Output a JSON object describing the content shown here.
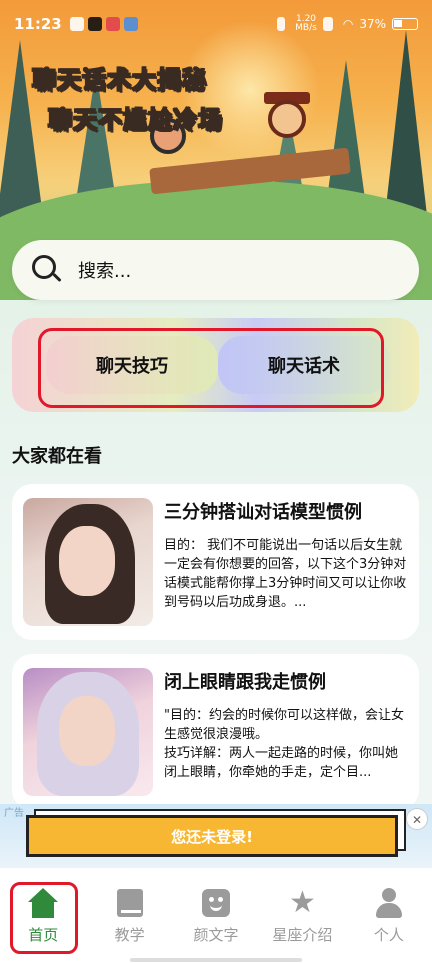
{
  "status_bar": {
    "time": "11:23",
    "network_speed": "1.20\nMB/s",
    "battery": "37%"
  },
  "hero": {
    "line1": "聊天话术大揭秘",
    "line2": "聊天不尴尬冷场"
  },
  "search": {
    "placeholder": "搜索..."
  },
  "features": [
    {
      "label": "聊天技巧"
    },
    {
      "label": "聊天话术"
    }
  ],
  "section": {
    "title": "大家都在看"
  },
  "cards": [
    {
      "title": "三分钟搭讪对话模型惯例",
      "desc": "目的： 我们不可能说出一句话以后女生就一定会有你想要的回答，以下这个3分钟对话模式能帮你撑上3分钟时间又可以让你收到号码以后功成身退。..."
    },
    {
      "title": "闭上眼睛跟我走惯例",
      "desc": "\"目的：约会的时候你可以这样做，会让女生感觉很浪漫哦。\n技巧详解：两人一起走路的时候，你叫她闭上眼睛，你牵她的手走，定个目..."
    }
  ],
  "ad": {
    "label": "广告",
    "banner": "您还未登录!",
    "close": "✕"
  },
  "nav": [
    {
      "label": "首页",
      "icon": "home-icon",
      "active": true
    },
    {
      "label": "教学",
      "icon": "book-icon",
      "active": false
    },
    {
      "label": "颜文字",
      "icon": "emoticon-icon",
      "active": false
    },
    {
      "label": "星座介绍",
      "icon": "star-icon",
      "active": false
    },
    {
      "label": "个人",
      "icon": "user-icon",
      "active": false
    }
  ],
  "colors": {
    "accent_green": "#2f8a3c",
    "highlight_red": "#e0182a",
    "banner_yellow": "#f8b733"
  }
}
